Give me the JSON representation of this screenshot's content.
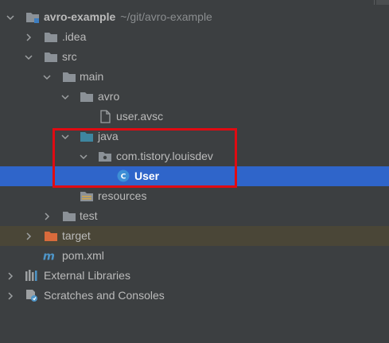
{
  "project": {
    "name": "avro-example",
    "path": "~/git/avro-example"
  },
  "tree": {
    "idea": ".idea",
    "src": "src",
    "main": "main",
    "avro": "avro",
    "user_avsc": "user.avsc",
    "java": "java",
    "package": "com.tistory.louisdev",
    "user_class": "User",
    "class_badge": "C",
    "resources": "resources",
    "test": "test",
    "target": "target",
    "pom": "pom.xml",
    "pom_badge": "m",
    "external_libraries": "External Libraries",
    "scratches": "Scratches and Consoles"
  },
  "colors": {
    "background": "#3c3f41",
    "selection": "#2f65ca",
    "excluded_row": "#4a4637",
    "annotation_box": "#e00b12",
    "folder": "#8b9197",
    "source_folder": "#3e86a0",
    "excluded_folder": "#d86b3c",
    "class_icon": "#3d8fd6"
  },
  "icons": {
    "expanded": "chevron-down-icon",
    "collapsed": "chevron-right-icon",
    "module": "module-folder-icon",
    "folder": "folder-icon",
    "source_root": "source-root-folder-icon",
    "package": "package-icon",
    "class": "java-class-icon",
    "resources": "resources-root-icon",
    "excluded": "excluded-folder-icon",
    "maven": "maven-icon",
    "libraries": "libraries-icon",
    "scratches": "scratches-icon"
  }
}
